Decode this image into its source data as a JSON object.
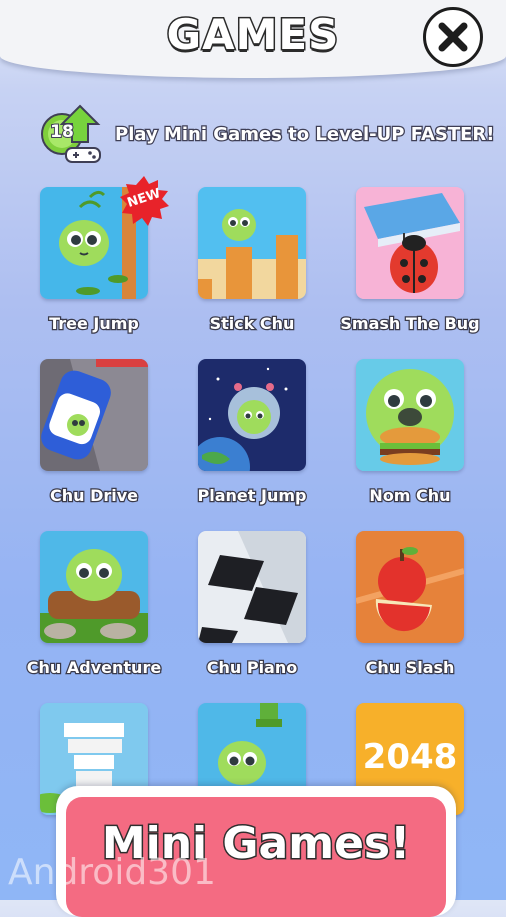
{
  "header": {
    "title": "GAMES",
    "close_icon": "close-icon"
  },
  "banner": {
    "level": "18",
    "text": "Play Mini Games to Level-UP FASTER!"
  },
  "badges": {
    "new": "NEW"
  },
  "games": [
    {
      "label": "Tree Jump"
    },
    {
      "label": "Stick Chu"
    },
    {
      "label": "Smash The Bug"
    },
    {
      "label": "Chu Drive"
    },
    {
      "label": "Planet Jump"
    },
    {
      "label": "Nom Chu"
    },
    {
      "label": "Chu Adventure"
    },
    {
      "label": "Chu Piano"
    },
    {
      "label": "Chu Slash"
    },
    {
      "label": ""
    },
    {
      "label": ""
    },
    {
      "label": "2048"
    }
  ],
  "bottom": {
    "button_label": "Mini Games!"
  },
  "watermark": {
    "text": "Android301"
  },
  "colors": {
    "accent_pink": "#f46b82",
    "background_blue": "#95b3f3",
    "chu_green": "#8bd450"
  }
}
